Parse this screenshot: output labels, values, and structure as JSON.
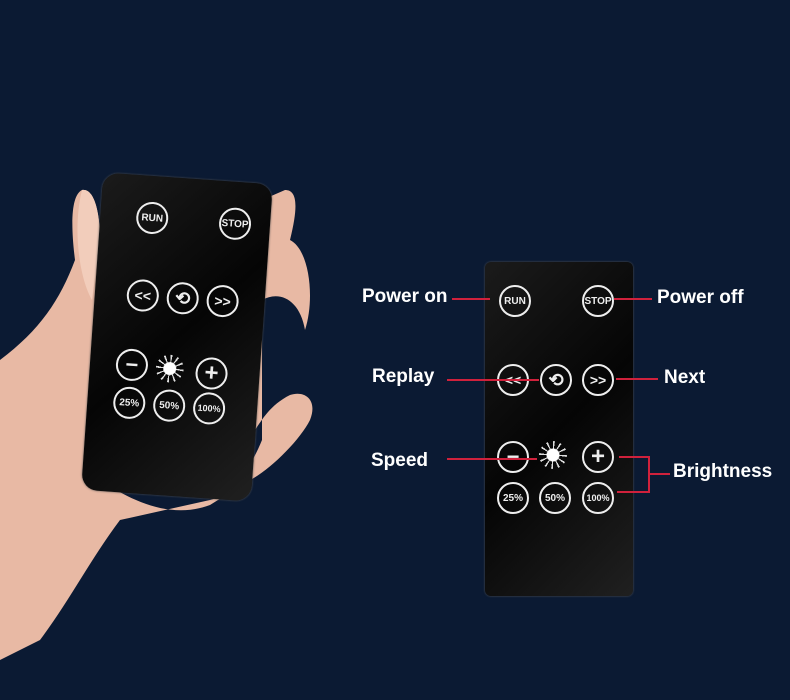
{
  "buttons": {
    "run": "RUN",
    "stop": "STOP",
    "rewind": "<<",
    "replay": "⟲",
    "forward": ">>",
    "minus": "−",
    "plus": "+",
    "p25": "25%",
    "p50": "50%",
    "p100": "100%"
  },
  "labels": {
    "power_on": "Power on",
    "power_off": "Power off",
    "replay": "Replay",
    "next": "Next",
    "speed": "Speed",
    "brightness": "Brightness"
  },
  "colors": {
    "background": "#0b1a33",
    "callout_line": "#d0213c"
  }
}
